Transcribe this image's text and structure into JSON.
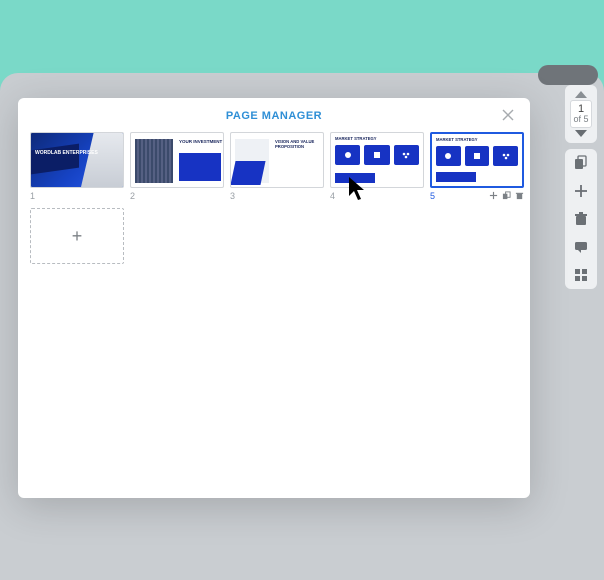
{
  "modal": {
    "title": "PAGE MANAGER"
  },
  "slides": [
    {
      "num": "1",
      "title": "WORDLAB ENTERPRISES",
      "selected": false
    },
    {
      "num": "2",
      "title": "YOUR INVESTMENT",
      "selected": false
    },
    {
      "num": "3",
      "title": "VISION AND VALUE PROPOSITION",
      "selected": false
    },
    {
      "num": "4",
      "title": "MARKET STRATEGY",
      "selected": false
    },
    {
      "num": "5",
      "title": "MARKET STRATEGY",
      "selected": true
    }
  ],
  "page_nav": {
    "current": "1",
    "total_label": "of 5"
  },
  "colors": {
    "accent": "#1f5ae0",
    "teal": "#7ad9c8"
  }
}
